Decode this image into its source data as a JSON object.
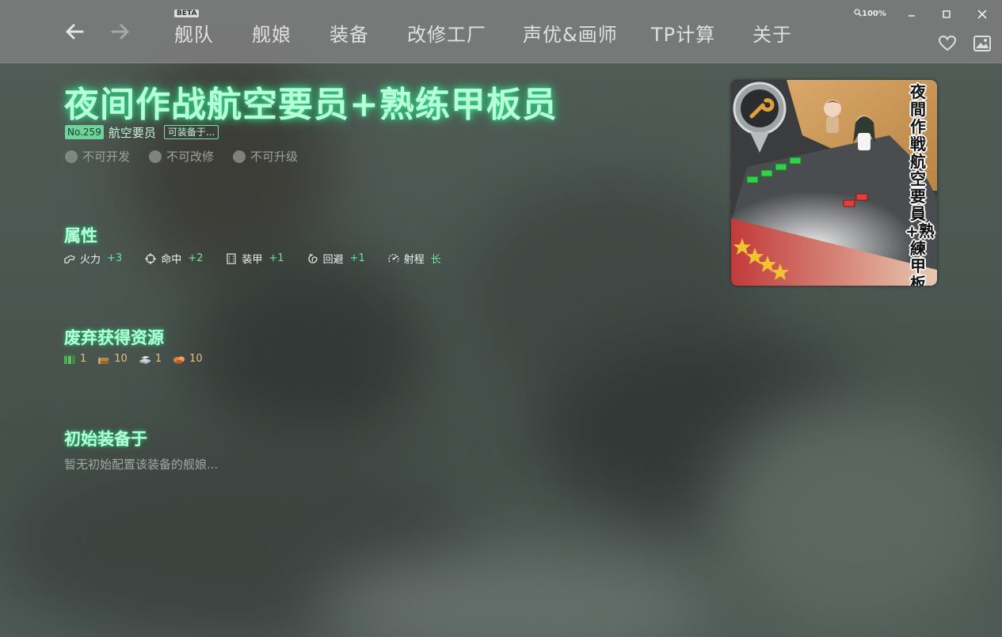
{
  "nav": {
    "items": [
      {
        "label": "舰队"
      },
      {
        "label": "舰娘"
      },
      {
        "label": "装备"
      },
      {
        "label": "改修工厂"
      },
      {
        "label": "声优&画师"
      },
      {
        "label": "TP计算"
      },
      {
        "label": "关于"
      }
    ],
    "beta_badge": "BETA",
    "zoom": "100%"
  },
  "equipment": {
    "name": "夜间作战航空要员+熟练甲板员",
    "number": "No.259",
    "type": "航空要员",
    "equip_tag": "可装备于...",
    "card_title": "夜間作戦航空要員+熟練甲板員",
    "card_stars": 4
  },
  "flags": [
    {
      "label": "不可开发"
    },
    {
      "label": "不可改修"
    },
    {
      "label": "不可升级"
    }
  ],
  "sections": {
    "stats_title": "属性",
    "scrap_title": "废弃获得资源",
    "initial_title": "初始装备于",
    "initial_empty": "暂无初始配置该装备的舰娘..."
  },
  "stats": [
    {
      "icon": "firepower-icon",
      "label": "火力",
      "value": "+3"
    },
    {
      "icon": "accuracy-icon",
      "label": "命中",
      "value": "+2"
    },
    {
      "icon": "armor-icon",
      "label": "装甲",
      "value": "+1"
    },
    {
      "icon": "evasion-icon",
      "label": "回避",
      "value": "+1"
    },
    {
      "icon": "range-icon",
      "label": "射程",
      "value": "长"
    }
  ],
  "scrap": [
    {
      "icon": "fuel-icon",
      "value": "1"
    },
    {
      "icon": "ammo-icon",
      "value": "10"
    },
    {
      "icon": "steel-icon",
      "value": "1"
    },
    {
      "icon": "bauxite-icon",
      "value": "10"
    }
  ],
  "colors": {
    "accent": "#6de3a0",
    "title_glow": "#39d98a",
    "topbar": "#808080"
  }
}
